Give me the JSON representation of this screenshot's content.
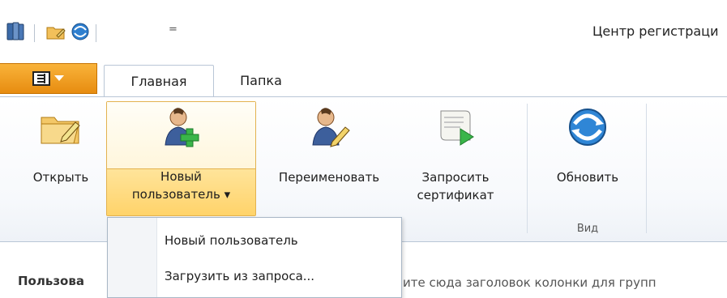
{
  "titlebar": {
    "window_title": "Центр регистраци",
    "qat_dropdown_glyph": "="
  },
  "tabs": {
    "active": "Главная",
    "inactive": "Папка"
  },
  "ribbon": {
    "open_label": "Открыть",
    "new_user_line1": "Новый",
    "new_user_line2": "пользователь ▾",
    "rename_label": "Переименовать",
    "request_line1": "Запросить",
    "request_line2": "сертификат",
    "refresh_label": "Обновить",
    "group_view": "Вид"
  },
  "menu": {
    "items": [
      "Новый пользователь",
      "Загрузить из запроса..."
    ]
  },
  "content": {
    "column_title": "Пользова",
    "group_hint": "ите сюда заголовок колонки для групп"
  },
  "colors": {
    "accent_orange": "#f0a020",
    "selected_yellow": "#ffe49a",
    "border": "#b9c6d6"
  }
}
